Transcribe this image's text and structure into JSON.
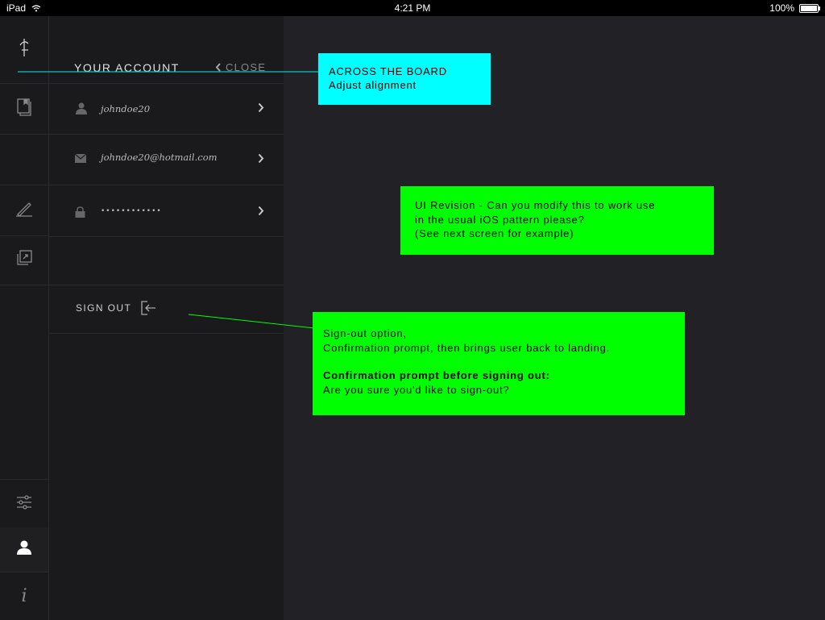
{
  "status_bar": {
    "device": "iPad",
    "time": "4:21 PM",
    "battery": "100%",
    "battery_level": 1.0
  },
  "rail": {
    "icons": [
      "logo-icon",
      "book-icon",
      "pen-icon",
      "gallery-icon",
      "settings-icon",
      "user-icon",
      "info-icon"
    ]
  },
  "account_panel": {
    "title": "YOUR ACCOUNT",
    "close_label": "CLOSE",
    "username": "johndoe20",
    "email": "johndoe20@hotmail.com",
    "password_mask": "••••••••••••",
    "sign_out_label": "SIGN OUT"
  },
  "annotations": {
    "cyan_note": {
      "line1": "ACROSS THE BOARD",
      "line2": "Adjust alignment",
      "color": "#00ffff"
    },
    "revision_note": {
      "line1": "UI Revision - Can you modify this to work use",
      "line2": "in the usual iOS pattern please?",
      "line3": "(See next screen for example)",
      "color": "#00ff00"
    },
    "signout_note": {
      "line1": "Sign-out option,",
      "line2": "Confirmation prompt, then brings user back to landing.",
      "line3": "Confirmation prompt before signing out:",
      "line4": "Are you sure you'd like to sign-out?",
      "color": "#00ff00"
    }
  }
}
